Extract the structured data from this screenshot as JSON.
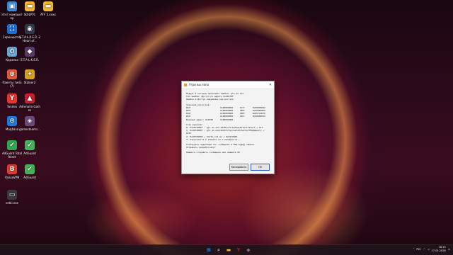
{
  "desktop": {
    "icons": [
      {
        "label": "Этот компьютер",
        "icon": "computer-icon",
        "color": "#3a8dde"
      },
      {
        "label": "SOILPTC",
        "icon": "folder-icon",
        "color": "#f2b632"
      },
      {
        "label": "ATF 5.xxxx",
        "icon": "folder-icon",
        "color": "#f2b632"
      },
      {
        "label": "Скриншотер",
        "icon": "screenshot-icon",
        "color": "#1f6fd6"
      },
      {
        "label": "S.T.A.L.K.E.R. 2 Heart of...",
        "icon": "stalker-icon",
        "color": "#2c3a4a"
      },
      {
        "label": "Корзина",
        "icon": "recycle-bin-icon",
        "color": "#6aa6d8"
      },
      {
        "label": "S.T.A.L.K.E.R.",
        "icon": "game-icon",
        "color": "#5a3a6a"
      },
      {
        "label": "Пакеты типа (7)",
        "icon": "package-icon",
        "color": "#e05a3a"
      },
      {
        "label": "Stalker2",
        "icon": "stalker2-icon",
        "color": "#d6a020"
      },
      {
        "label": "Yandex",
        "icon": "yandex-icon",
        "color": "#e8342b"
      },
      {
        "label": "Adrenalin Games",
        "icon": "adrenalin-icon",
        "color": "#c81f2e"
      },
      {
        "label": "Модбаза",
        "icon": "modbase-icon",
        "color": "#1e7be0"
      },
      {
        "label": "gamesteams...",
        "icon": "games-icon",
        "color": "#6a4a7a"
      },
      {
        "label": "AdGuard Total Reset",
        "icon": "adguard-icon",
        "color": "#2fa84f"
      },
      {
        "label": "AdGuard",
        "icon": "adguard-icon",
        "color": "#43b35a"
      },
      {
        "label": "VanyaVPN",
        "icon": "vpn-icon",
        "color": "#e03a2a"
      },
      {
        "label": "AdGuard",
        "icon": "adguard-icon",
        "color": "#43b35a"
      },
      {
        "label": "setki.exe",
        "icon": "app-icon",
        "color": "#3a3a3a"
      }
    ]
  },
  "dialog": {
    "title": "Утри вы папа",
    "close": "✕",
    "intro": [
      "Модуль в котором произошла ошибка: gfx_dx.exe",
      "Тип ошибки: Доступ по адресу 0x00578F",
      "Ошибка в Доступ нарушение при доступе"
    ],
    "registers_title": "Значения регистров:",
    "registers": [
      [
        "RAX:",
        "0x00000000",
        "RCX:",
        "0x00000042"
      ],
      [
        "RDX:",
        "0x00000000",
        "RBX:",
        "0x00000060"
      ],
      [
        "RSP:",
        "0x00000000",
        "RBP:",
        "0x00710070"
      ],
      [
        "RSI:",
        "0x00000000",
        "RDI:",
        "0x00000015"
      ],
      [
        "Базовый адрес: 0x0700",
        "0x00000000",
        "",
        ""
      ]
    ],
    "stack_title": "Стек вызовов:",
    "stack": [
      "0: 0x00740B07 — gfx_dx.exe_2638w/FormatGetEffectiStart + 0x3",
      "1: 0x00740B07 — gfx_dx.exe+0x2C5/SyncSetId/SetterFPRgbQuery + 0x57",
      "2: 0x00700000 + 0xdfm_ret_dx + 0x0270600",
      "3: Запускается в комнате на и вызывается..."
    ],
    "message": [
      "Скопируйте подробный лог сообщения в Ваш буфер обмена.",
      "Отправить разработчику?"
    ],
    "footer": "Нажмите отправить сообщение или нажмите ОК",
    "buttons": {
      "copy": "Копировать",
      "ok": "ОК"
    }
  },
  "taskbar": {
    "apps": [
      {
        "name": "start",
        "icon": "windows-start-icon",
        "color": "#3aa0ff"
      },
      {
        "name": "search",
        "icon": "search-icon",
        "color": "#ffffff"
      },
      {
        "name": "explorer",
        "icon": "file-explorer-icon",
        "color": "#f2b632"
      },
      {
        "name": "yandex",
        "icon": "yandex-icon",
        "color": "#e8342b"
      },
      {
        "name": "game",
        "icon": "game-icon",
        "color": "#8a6a8a"
      }
    ],
    "language": "РУС",
    "time": "18:15",
    "date": "17.01.2026"
  }
}
